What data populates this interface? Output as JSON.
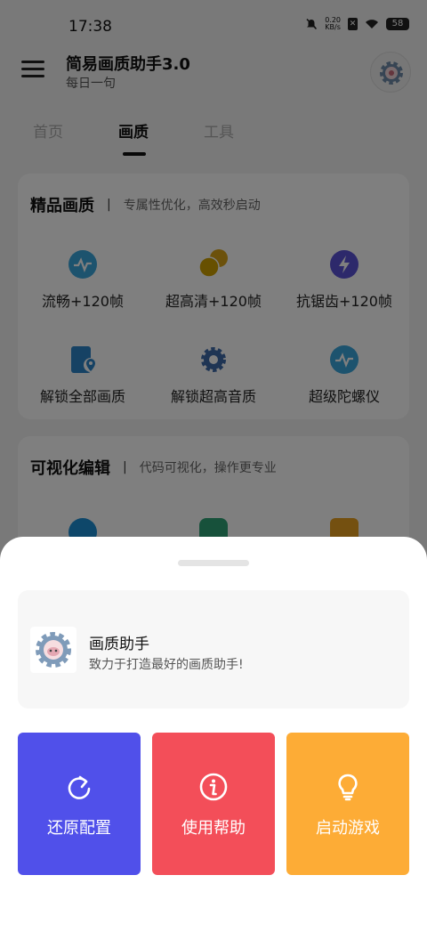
{
  "status_bar": {
    "time": "17:38",
    "network_speed_value": "0.20",
    "network_speed_unit": "KB/s",
    "battery": "58",
    "icons": [
      "mute-icon",
      "x-notification-icon",
      "wifi-icon",
      "battery-icon"
    ]
  },
  "header": {
    "title": "简易画质助手3.0",
    "subtitle": "每日一句",
    "settings_icon": "gear-icon"
  },
  "tabs": [
    {
      "label": "首页",
      "active": false
    },
    {
      "label": "画质",
      "active": true
    },
    {
      "label": "工具",
      "active": false
    }
  ],
  "sections": [
    {
      "title": "精品画质",
      "subtitle": "专属性优化，高效秒启动",
      "items": [
        {
          "label": "流畅+120帧",
          "icon": "pulse-icon",
          "color": "#3aa6dc"
        },
        {
          "label": "超高清+120帧",
          "icon": "coins-icon",
          "color": "#d8a316"
        },
        {
          "label": "抗锯齿+120帧",
          "icon": "lightning-icon",
          "color": "#5b52d6"
        },
        {
          "label": "解锁全部画质",
          "icon": "file-location-icon",
          "color": "#2d84c8"
        },
        {
          "label": "解锁超高音质",
          "icon": "gear-icon",
          "color": "#3f6aa8"
        },
        {
          "label": "超级陀螺仪",
          "icon": "pulse-icon",
          "color": "#3aa6dc"
        }
      ]
    },
    {
      "title": "可视化编辑",
      "subtitle": "代码可视化，操作更专业",
      "items": [
        {
          "label": "",
          "icon": "wave-icon",
          "color": "#1d8fd4"
        },
        {
          "label": "",
          "icon": "shield-icon",
          "color": "#2fa276"
        },
        {
          "label": "",
          "icon": "document-icon",
          "color": "#e8a020"
        }
      ]
    }
  ],
  "sheet": {
    "app_name": "画质助手",
    "app_desc": "致力于打造最好的画质助手!",
    "actions": [
      {
        "label": "还原配置",
        "icon": "refresh-icon",
        "color": "#5050ea"
      },
      {
        "label": "使用帮助",
        "icon": "info-icon",
        "color": "#f34e59"
      },
      {
        "label": "启动游戏",
        "icon": "lightbulb-icon",
        "color": "#fdac36"
      }
    ]
  }
}
